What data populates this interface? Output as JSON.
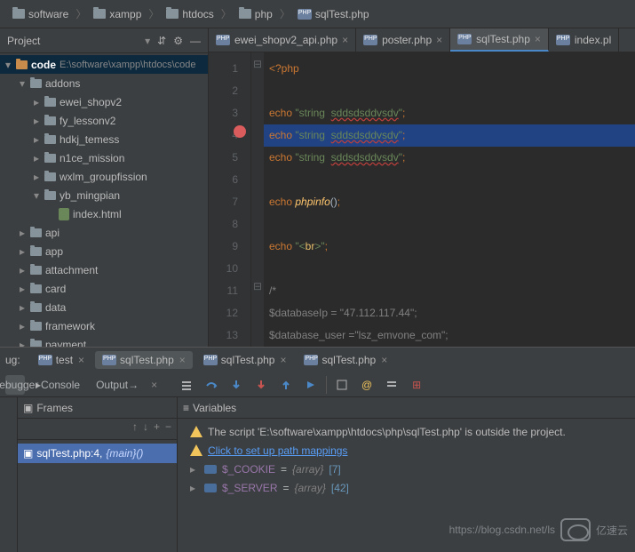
{
  "breadcrumb": [
    {
      "label": "software",
      "type": "folder"
    },
    {
      "label": "xampp",
      "type": "folder"
    },
    {
      "label": "htdocs",
      "type": "folder"
    },
    {
      "label": "php",
      "type": "folder"
    },
    {
      "label": "sqlTest.php",
      "type": "php"
    }
  ],
  "project": {
    "title": "Project",
    "root": {
      "name": "code",
      "path": "E:\\software\\xampp\\htdocs\\code"
    },
    "nodes": [
      {
        "indent": 1,
        "arrow": "▾",
        "icon": "dir",
        "label": "addons"
      },
      {
        "indent": 2,
        "arrow": "▸",
        "icon": "dir",
        "label": "ewei_shopv2"
      },
      {
        "indent": 2,
        "arrow": "▸",
        "icon": "dir",
        "label": "fy_lessonv2"
      },
      {
        "indent": 2,
        "arrow": "▸",
        "icon": "dir",
        "label": "hdkj_temess"
      },
      {
        "indent": 2,
        "arrow": "▸",
        "icon": "dir",
        "label": "n1ce_mission"
      },
      {
        "indent": 2,
        "arrow": "▸",
        "icon": "dir",
        "label": "wxlm_groupfission"
      },
      {
        "indent": 2,
        "arrow": "▾",
        "icon": "dir",
        "label": "yb_mingpian"
      },
      {
        "indent": 3,
        "arrow": "",
        "icon": "html",
        "label": "index.html"
      },
      {
        "indent": 1,
        "arrow": "▸",
        "icon": "dir",
        "label": "api"
      },
      {
        "indent": 1,
        "arrow": "▸",
        "icon": "dir",
        "label": "app"
      },
      {
        "indent": 1,
        "arrow": "▸",
        "icon": "dir",
        "label": "attachment"
      },
      {
        "indent": 1,
        "arrow": "▸",
        "icon": "dir",
        "label": "card"
      },
      {
        "indent": 1,
        "arrow": "▸",
        "icon": "dir",
        "label": "data"
      },
      {
        "indent": 1,
        "arrow": "▸",
        "icon": "dir",
        "label": "framework"
      },
      {
        "indent": 1,
        "arrow": "▸",
        "icon": "dir",
        "label": "payment"
      }
    ]
  },
  "editor": {
    "tabs": [
      {
        "label": "ewei_shopv2_api.php",
        "active": false
      },
      {
        "label": "poster.php",
        "active": false
      },
      {
        "label": "sqlTest.php",
        "active": true
      },
      {
        "label": "index.pl",
        "active": false
      }
    ],
    "lines": [
      "1",
      "2",
      "3",
      "4",
      "5",
      "6",
      "7",
      "8",
      "9",
      "10",
      "11",
      "12",
      "13"
    ],
    "breakpointLine": 4,
    "code": {
      "l1_open": "<?php",
      "echo": "echo",
      "str_kw": "string",
      "bad": "sddsdsddvsdv",
      "phpinfo": "phpinfo",
      "br_q1": "\"<",
      "br_tag": "br",
      "br_q2": ">\"",
      "cmt_open": "/*",
      "db_ip": "$databaseIp = \"47.112.117.44\";",
      "db_user": "$database_user =\"lsz_emvone_com\";"
    }
  },
  "debug": {
    "label_prefix": "ug:",
    "tabs": [
      {
        "label": "test"
      },
      {
        "label": "sqlTest.php"
      },
      {
        "label": "sqlTest.php"
      },
      {
        "label": "sqlTest.php"
      }
    ],
    "toolbar_tabs": {
      "debugger": "Debugger",
      "console": "Console",
      "output": "Output"
    },
    "frames_title": "Frames",
    "vars_title": "Variables",
    "frame": {
      "file": "sqlTest.php:4,",
      "fn": "{main}()"
    },
    "warn1": "The script 'E:\\software\\xampp\\htdocs\\php\\sqlTest.php' is outside the project.",
    "warn2_link": "Click to set up path mappings",
    "vars": [
      {
        "name": "$_COOKIE",
        "type": "{array}",
        "count": "[7]"
      },
      {
        "name": "$_SERVER",
        "type": "{array}",
        "count": "[42]"
      }
    ]
  },
  "watermark": {
    "url": "https://blog.csdn.net/ls",
    "brand": "亿速云"
  }
}
